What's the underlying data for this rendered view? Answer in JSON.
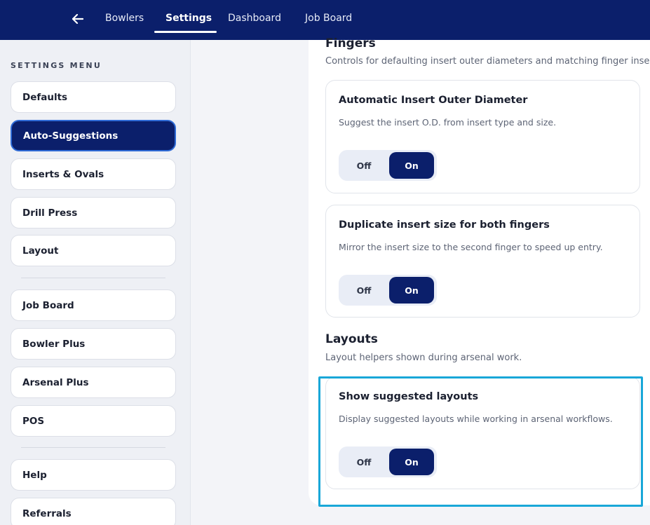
{
  "nav": {
    "tabs": [
      {
        "label": "Bowlers"
      },
      {
        "label": "Settings"
      },
      {
        "label": "Dashboard"
      },
      {
        "label": "Job Board"
      }
    ],
    "active_tab": "Settings",
    "back_icon": "arrow-left-icon"
  },
  "sidebar": {
    "heading": "SETTINGS MENU",
    "items": [
      {
        "label": "Defaults"
      },
      {
        "label": "Auto-Suggestions"
      },
      {
        "label": "Inserts & Ovals"
      },
      {
        "label": "Drill Press"
      },
      {
        "label": "Layout"
      },
      {
        "label": "Job Board"
      },
      {
        "label": "Bowler Plus"
      },
      {
        "label": "Arsenal Plus"
      },
      {
        "label": "POS"
      },
      {
        "label": "Help"
      },
      {
        "label": "Referrals"
      }
    ],
    "active_item": "Auto-Suggestions"
  },
  "main": {
    "sections": [
      {
        "title": "Fingers",
        "description": "Controls for defaulting insert outer diameters and matching finger inserts.",
        "cards": [
          {
            "title": "Automatic Insert Outer Diameter",
            "description": "Suggest the insert O.D. from insert type and size.",
            "off_label": "Off",
            "on_label": "On",
            "value": "On"
          },
          {
            "title": "Duplicate insert size for both fingers",
            "description": "Mirror the insert size to the second finger to speed up entry.",
            "off_label": "Off",
            "on_label": "On",
            "value": "On"
          }
        ]
      },
      {
        "title": "Layouts",
        "description": "Layout helpers shown during arsenal work.",
        "cards": [
          {
            "title": "Show suggested layouts",
            "description": "Display suggested layouts while working in arsenal workflows.",
            "off_label": "Off",
            "on_label": "On",
            "value": "On"
          }
        ]
      }
    ]
  },
  "colors": {
    "nav_background": "#0b1f6b",
    "accent": "#0b1f6b",
    "highlight": "#19a7d8",
    "sidebar_background": "#eef0f5"
  }
}
